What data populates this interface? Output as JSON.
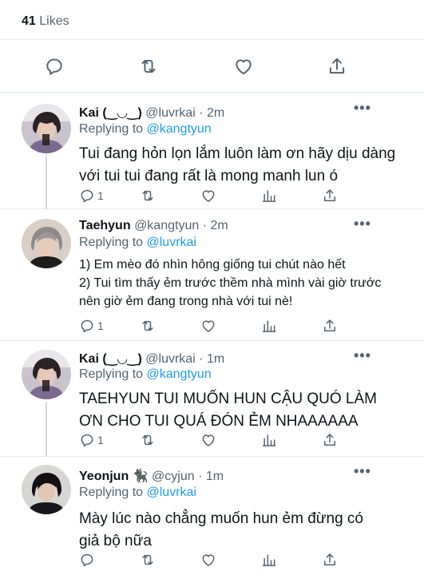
{
  "likes": {
    "count": "41",
    "label": "Likes"
  },
  "main_actions": [
    "reply-icon",
    "retweet-icon",
    "like-icon",
    "share-icon"
  ],
  "tweets": [
    {
      "name": "Kai (‿◡‿)",
      "handle": "@luvrkai",
      "dot": "·",
      "time": "2m",
      "replying_label": "Replying to",
      "replying_to": "@kangtyun",
      "text": "Tui đang hỏn lọn lắm luôn làm ơn hãy dịu dàng với tui tui đang rất là mong manh lun ó",
      "reply_count": "1",
      "more": "•••"
    },
    {
      "name": "Taehyun",
      "handle": "@kangtyun",
      "dot": "·",
      "time": "2m",
      "replying_label": "Replying to",
      "replying_to": "@luvrkai",
      "text_lines": [
        "1) Em mèo đó nhìn hông giống tui chút nào hết",
        "2) Tui tìm thấy ẻm trước thềm nhà mình vài giờ trước nên giờ ẻm đang trong nhà với tui nè!"
      ],
      "reply_count": "1",
      "more": "•••"
    },
    {
      "name": "Kai (‿◡‿)",
      "handle": "@luvrkai",
      "dot": "·",
      "time": "1m",
      "replying_label": "Replying to",
      "replying_to": "@kangtyun",
      "text": "TAEHYUN TUI MUỐN HUN CẬU QUÓ LÀM ƠN CHO TUI QUÁ ĐÓN ẺM NHAAAAAA",
      "reply_count": "1",
      "more": "•••"
    },
    {
      "name": "Yeonjun 🐈‍⬛",
      "handle": "@cyjun",
      "dot": "·",
      "time": "1m",
      "replying_label": "Replying to",
      "replying_to": "@luvrkai",
      "text": "Mày lúc nào chẳng muốn hun ẻm đừng có giả bộ nữa",
      "reply_count": "",
      "more": "•••"
    }
  ],
  "colors": {
    "text": "#0f1419",
    "secondary": "#536471",
    "link": "#1d9bf0",
    "divider": "#e6ecf0",
    "thread_line": "#cfd9de"
  }
}
